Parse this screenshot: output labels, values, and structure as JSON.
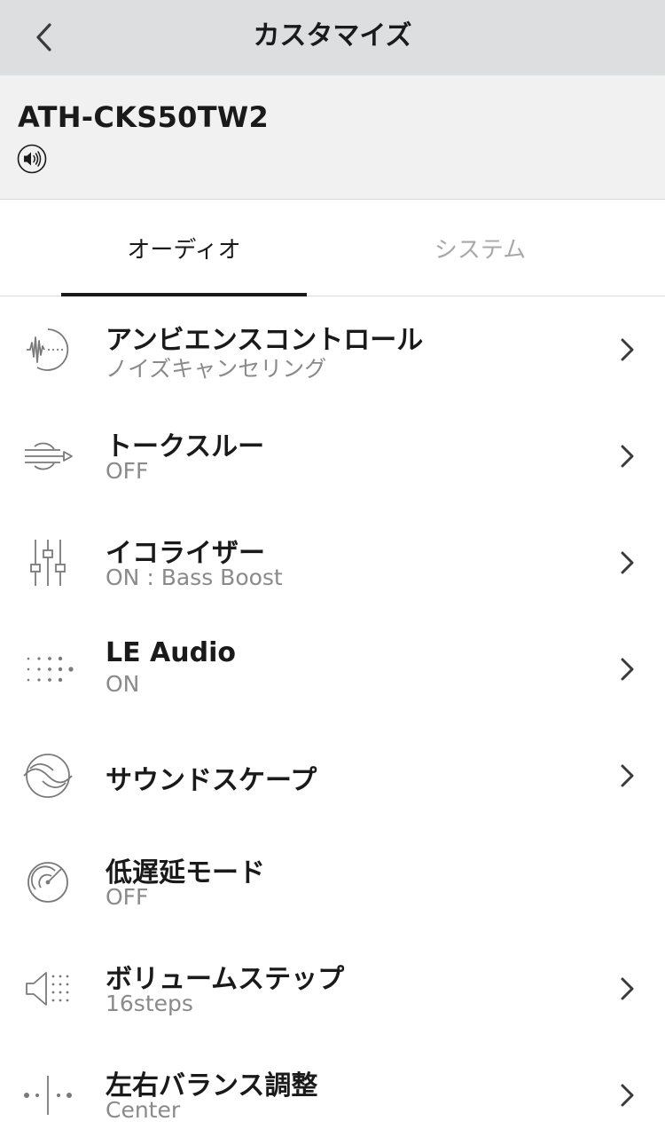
{
  "nav": {
    "title": "カスタマイズ",
    "back_icon": "chevron-left-icon"
  },
  "device": {
    "name": "ATH-CKS50TW2",
    "speaker_icon": "speaker-icon"
  },
  "tabs": [
    {
      "label": "オーディオ",
      "active": true
    },
    {
      "label": "システム",
      "active": false
    }
  ],
  "items": [
    {
      "title": "アンビエンスコントロール",
      "subtitle": "ノイズキャンセリング",
      "icon": "ambient-sound-icon",
      "chevron": true
    },
    {
      "title": "トークスルー",
      "subtitle": "OFF",
      "icon": "talk-through-icon",
      "chevron": true
    },
    {
      "title": "イコライザー",
      "subtitle": "ON : Bass Boost",
      "icon": "equalizer-icon",
      "chevron": true
    },
    {
      "title": "LE Audio",
      "subtitle": "ON",
      "icon": "le-audio-icon",
      "chevron": true
    },
    {
      "title": "サウンドスケープ",
      "subtitle": "",
      "icon": "soundscape-icon",
      "chevron": true
    },
    {
      "title": "低遅延モード",
      "subtitle": "OFF",
      "icon": "low-latency-icon",
      "chevron": false
    },
    {
      "title": "ボリュームステップ",
      "subtitle": "16steps",
      "icon": "volume-step-icon",
      "chevron": true
    },
    {
      "title": "左右バランス調整",
      "subtitle": "Center",
      "icon": "balance-icon",
      "chevron": true
    }
  ],
  "colors": {
    "navbar_bg": "#dcdedf",
    "header_bg": "#f1f1f1",
    "text_primary": "#1a1a1a",
    "text_secondary": "#8a8a8a",
    "tab_inactive": "#a8a8a8",
    "icon_gray": "#7a7a7a"
  }
}
